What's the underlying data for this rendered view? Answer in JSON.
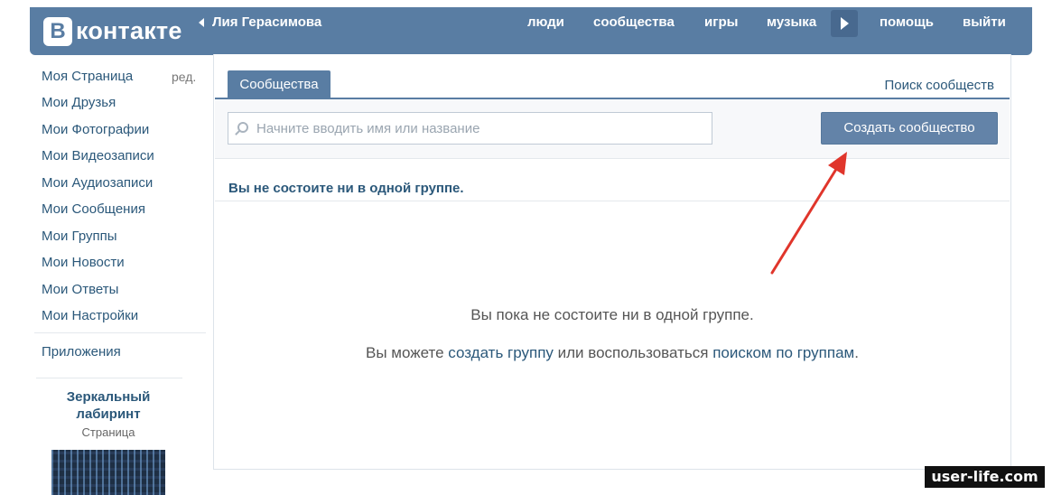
{
  "header": {
    "logo_letter": "B",
    "logo_text": "контакте",
    "back_label": "Лия Герасимова",
    "nav": [
      "люди",
      "сообщества",
      "игры",
      "музыка",
      "помощь",
      "выйти"
    ]
  },
  "sidebar": {
    "items": [
      {
        "label": "Моя Страница"
      },
      {
        "label": "Мои Друзья"
      },
      {
        "label": "Мои Фотографии"
      },
      {
        "label": "Мои Видеозаписи"
      },
      {
        "label": "Мои Аудиозаписи"
      },
      {
        "label": "Мои Сообщения"
      },
      {
        "label": "Мои Группы"
      },
      {
        "label": "Мои Новости"
      },
      {
        "label": "Мои Ответы"
      },
      {
        "label": "Мои Настройки"
      }
    ],
    "edit_label": "ред.",
    "apps_label": "Приложения",
    "promo": {
      "title": "Зеркальный лабиринт",
      "subtitle": "Страница"
    }
  },
  "main": {
    "tab_label": "Сообщества",
    "search_link": "Поиск сообществ",
    "search_placeholder": "Начните вводить имя или название",
    "create_button": "Создать сообщество",
    "section_title": "Вы не состоите ни в одной группе.",
    "empty_line1": "Вы пока не состоите ни в одной группе.",
    "empty_line2": {
      "prefix": "Вы можете ",
      "link1": "создать группу",
      "middle": " или воспользоваться ",
      "link2": "поиском по группам",
      "suffix": "."
    }
  },
  "watermark": "user-life.com",
  "colors": {
    "header": "#597da3",
    "link": "#2b587a",
    "button": "#6383a8",
    "arrow": "#e0352b"
  }
}
